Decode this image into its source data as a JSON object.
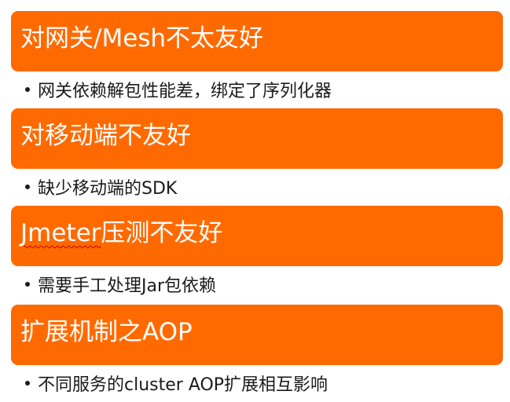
{
  "colors": {
    "band_fill": "#ff6a00",
    "band_text": "#ffffff",
    "bullet_text": "#1a1a1a",
    "spellcheck_underline": "#c00000"
  },
  "sections": [
    {
      "title": "对网关/Mesh不太友好",
      "point": "网关依赖解包性能差，绑定了序列化器"
    },
    {
      "title": "对移动端不友好",
      "point": "缺少移动端的SDK"
    },
    {
      "title_word": "Jmeter",
      "title_rest": "压测不友好",
      "point": "需要手工处理Jar包依赖"
    },
    {
      "title": "扩展机制之AOP",
      "point": "不同服务的cluster AOP扩展相互影响"
    }
  ]
}
